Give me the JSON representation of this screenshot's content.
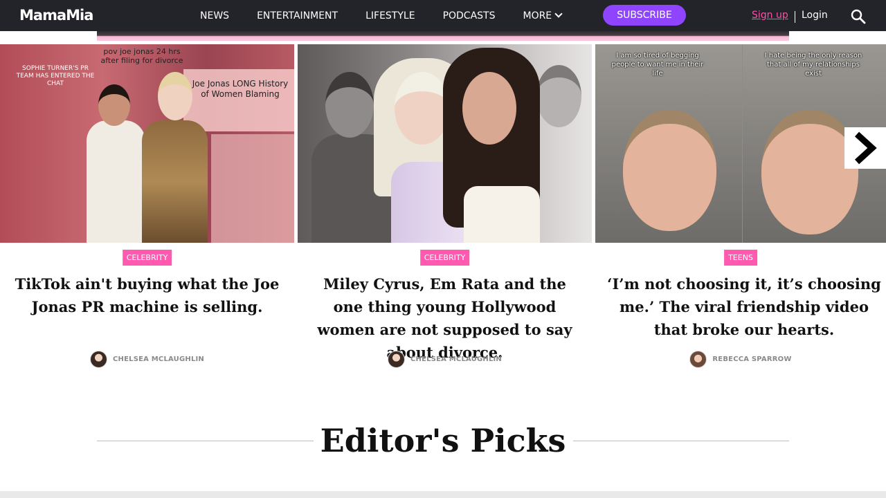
{
  "header": {
    "logo": "MamaMia",
    "nav": [
      "NEWS",
      "ENTERTAINMENT",
      "LIFESTYLE",
      "PODCASTS",
      "MORE"
    ],
    "subscribe_label": "SUBSCRIBE",
    "signup_label": "Sign up",
    "login_label": "Login"
  },
  "cards": [
    {
      "tag": "CELEBRITY",
      "title": "TikTok ain't buying what the Joe Jonas PR machine is selling.",
      "author": "CHELSEA MCLAUGHLIN",
      "image_text": [
        "pov joe jonas 24 hrs after filing for divorce",
        "Joe Jonas LONG History of Women Blaming",
        "SOPHIE TURNER'S PR TEAM HAS ENTERED THE CHAT"
      ]
    },
    {
      "tag": "CELEBRITY",
      "title": "Miley Cyrus, Em Rata and the one thing young Hollywood women are not supposed to say about divorce.",
      "author": "CHELSEA MCLAUGHLIN"
    },
    {
      "tag": "TEENS",
      "title": "‘I’m not choosing it, it’s choosing me.’ The viral friendship video that broke our hearts.",
      "author": "REBECCA SPARROW",
      "image_text": [
        "I am so tired of begging people to want me in their life",
        "I hate being the only reason that all of my relationships exist"
      ]
    }
  ],
  "section": {
    "title": "Editor's Picks"
  },
  "colors": {
    "nav_bg": "#23232a",
    "accent_pink": "#ff5ab0",
    "subscribe_purple": "#8f45ff"
  }
}
